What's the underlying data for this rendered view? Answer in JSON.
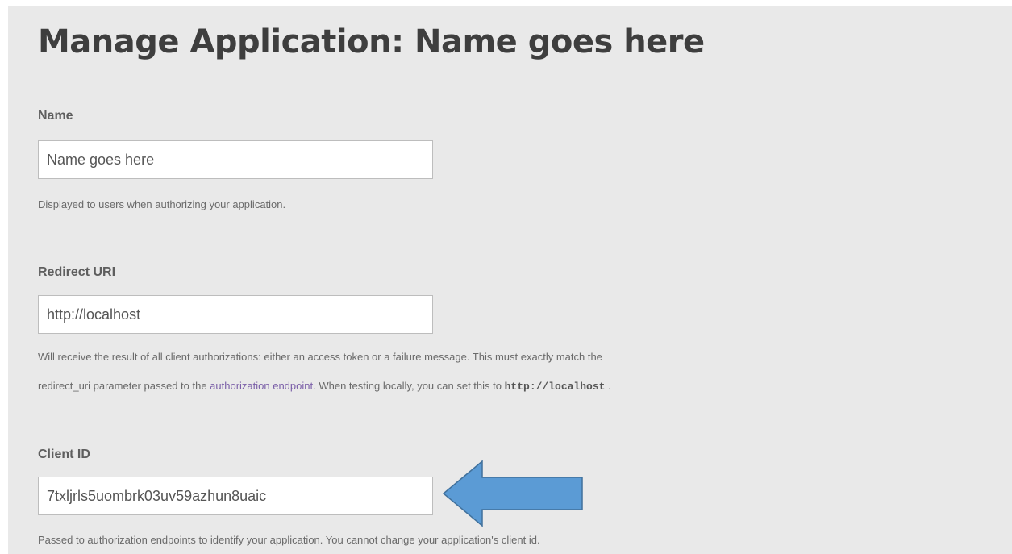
{
  "page": {
    "title": "Manage Application: Name goes here"
  },
  "fields": {
    "name": {
      "label": "Name",
      "value": "Name goes here",
      "help": "Displayed to users when authorizing your application."
    },
    "redirect_uri": {
      "label": "Redirect URI",
      "value": "http://localhost",
      "help_line1": "Will receive the result of all client authorizations: either an access token or a failure message. This must exactly match the",
      "help_line2_prefix": "redirect_uri parameter passed to the ",
      "help_link": "authorization endpoint",
      "help_line2_middle": ". When testing locally, you can set this to ",
      "help_code": "http://localhost",
      "help_line2_suffix": " ."
    },
    "client_id": {
      "label": "Client ID",
      "value": "7txljrls5uombrk03uv59azhun8uaic",
      "help": "Passed to authorization endpoints to identify your application. You cannot change your application's client id."
    }
  },
  "annotation": {
    "arrow_color": "#5b9bd5",
    "arrow_outline": "#41719c",
    "icon": "left-arrow-icon"
  },
  "colors": {
    "background": "#e9e9e9",
    "link": "#7b5fa8"
  }
}
